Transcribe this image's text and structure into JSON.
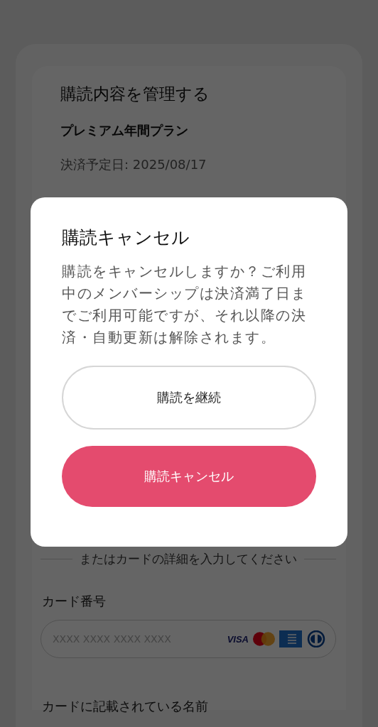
{
  "subscription": {
    "title": "購読内容を管理する",
    "plan": "プレミアム年間プラン",
    "next_billing": "決済予定日: 2025/08/17"
  },
  "payment": {
    "divider": "またはカードの詳細を入力してください",
    "card_number_label": "カード番号",
    "card_number_placeholder": "XXXX XXXX XXXX XXXX",
    "brands": [
      {
        "kind": "visa",
        "label": "VISA"
      },
      {
        "kind": "mastercard"
      },
      {
        "kind": "amex"
      },
      {
        "kind": "diners"
      }
    ],
    "name_label": "カードに記載されている名前"
  },
  "dialog": {
    "title": "購読キャンセル",
    "message": "購読をキャンセルしますか？ご利用中のメンバーシップは決済満了日までご利用可能ですが、それ以降の決済・自動更新は解除されます。",
    "buttons": [
      {
        "kind": "secondary",
        "label": "購読を継続"
      },
      {
        "kind": "danger",
        "label": "購読キャンセル"
      }
    ]
  }
}
